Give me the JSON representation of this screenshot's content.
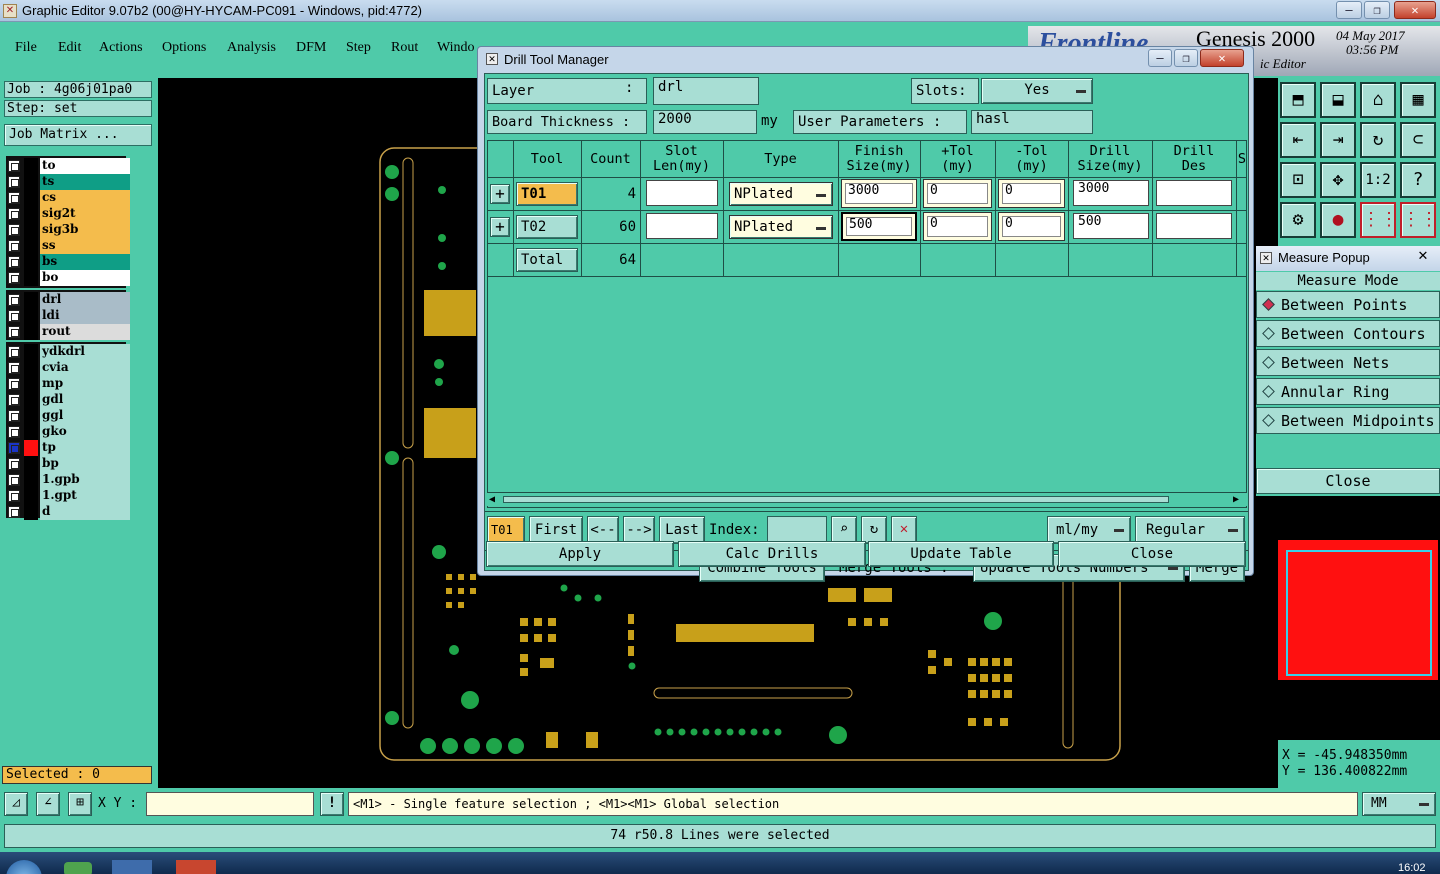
{
  "window": {
    "title": "Graphic Editor 9.07b2 (00@HY-HYCAM-PC091 - Windows, pid:4772)",
    "minimize": "—",
    "maximize": "❐",
    "close": "✕"
  },
  "menu": [
    "File",
    "Edit",
    "Actions",
    "Options",
    "Analysis",
    "DFM",
    "Step",
    "Rout",
    "Windo"
  ],
  "brand": {
    "product": "Genesis 2000",
    "date": "04 May 2017",
    "time": "03:56 PM",
    "logo_text": "Frontline",
    "subtitle": "ic Editor"
  },
  "left_panel": {
    "job": "Job : 4g06j01pa0",
    "step": "Step: set",
    "job_matrix": "Job Matrix ...",
    "layers": [
      {
        "name": "to",
        "color": "#ffffff"
      },
      {
        "name": "ts",
        "color": "#0f9e86"
      },
      {
        "name": "cs",
        "color": "#f4bc4c"
      },
      {
        "name": "sig2t",
        "color": "#f4bc4c"
      },
      {
        "name": "sig3b",
        "color": "#f4bc4c"
      },
      {
        "name": "ss",
        "color": "#f4bc4c"
      },
      {
        "name": "bs",
        "color": "#0f9e86"
      },
      {
        "name": "bo",
        "color": "#ffffff"
      },
      {
        "name": "drl",
        "color": "#a9bcc8"
      },
      {
        "name": "ldi",
        "color": "#a9bcc8"
      },
      {
        "name": "rout",
        "color": "#dcdcdc"
      },
      {
        "name": "ydkdrl",
        "color": "#a8ded4"
      },
      {
        "name": "cvia",
        "color": "#a8ded4"
      },
      {
        "name": "mp",
        "color": "#a8ded4"
      },
      {
        "name": "gdl",
        "color": "#a8ded4"
      },
      {
        "name": "ggl",
        "color": "#a8ded4"
      },
      {
        "name": "gko",
        "color": "#a8ded4"
      },
      {
        "name": "tp",
        "color": "#a8ded4"
      },
      {
        "name": "bp",
        "color": "#a8ded4"
      },
      {
        "name": "1.gpb",
        "color": "#a8ded4"
      },
      {
        "name": "1.gpt",
        "color": "#a8ded4"
      },
      {
        "name": "d",
        "color": "#a8ded4"
      }
    ],
    "selected": "Selected : 0"
  },
  "dtm": {
    "title": "Drill Tool Manager",
    "layer_label": "Layer",
    "layer_colon": ":",
    "layer_value": "drl",
    "slots_label": "Slots:",
    "slots_value": "Yes",
    "thickness_label": "Board Thickness :",
    "thickness_value": "2000",
    "thickness_unit": "my",
    "user_params_label": "User Parameters :",
    "user_params_value": "hasl",
    "headers": {
      "tool": "Tool",
      "count": "Count",
      "slot1": "Slot",
      "slot2": "Len(my)",
      "type": "Type",
      "finish1": "Finish",
      "finish2": "Size(my)",
      "ptol1": "+Tol",
      "ptol2": "(my)",
      "ntol1": "-Tol",
      "ntol2": "(my)",
      "drill1": "Drill",
      "drill2": "Size(my)",
      "des1": "Drill",
      "des2": "Des",
      "extra": "S"
    },
    "rows": [
      {
        "tool": "T01",
        "count": "4",
        "slot_len": "",
        "type": "NPlated",
        "finish": "3000",
        "ptol": "0",
        "ntol": "0",
        "drill": "3000",
        "des": ""
      },
      {
        "tool": "T02",
        "count": "60",
        "slot_len": "",
        "type": "NPlated",
        "finish": "500",
        "ptol": "0",
        "ntol": "0",
        "drill": "500",
        "des": ""
      }
    ],
    "total_label": "Total",
    "total_count": "64",
    "nav": {
      "current": "T01",
      "first": "First",
      "prev": "<--",
      "next": "-->",
      "last": "Last",
      "index_label": "Index:",
      "units": "ml/my",
      "mode": "Regular"
    },
    "combine": "Combine Tools",
    "merge_label": "Merge Tools :",
    "merge_option": "Update Tools Numbers",
    "merge": "Merge",
    "apply": "Apply",
    "calc": "Calc Drills",
    "update": "Update Table",
    "close": "Close",
    "expand": "+"
  },
  "measure": {
    "title": "Measure Popup",
    "mode": "Measure Mode",
    "options": [
      "Between Points",
      "Between Contours",
      "Between Nets",
      "Annular Ring",
      "Between Midpoints"
    ],
    "selected_index": 0,
    "close": "Close",
    "x_readout": "X = -45.948350mm",
    "y_readout": "Y = 136.400822mm"
  },
  "status": {
    "xy_label": "X Y :",
    "xy_value": "",
    "hint": "<M1> - Single feature selection ; <M1><M1> Global selection",
    "units": "MM",
    "message": "74 r50.8 Lines were selected"
  },
  "taskbar": {
    "clock": "16:02"
  }
}
